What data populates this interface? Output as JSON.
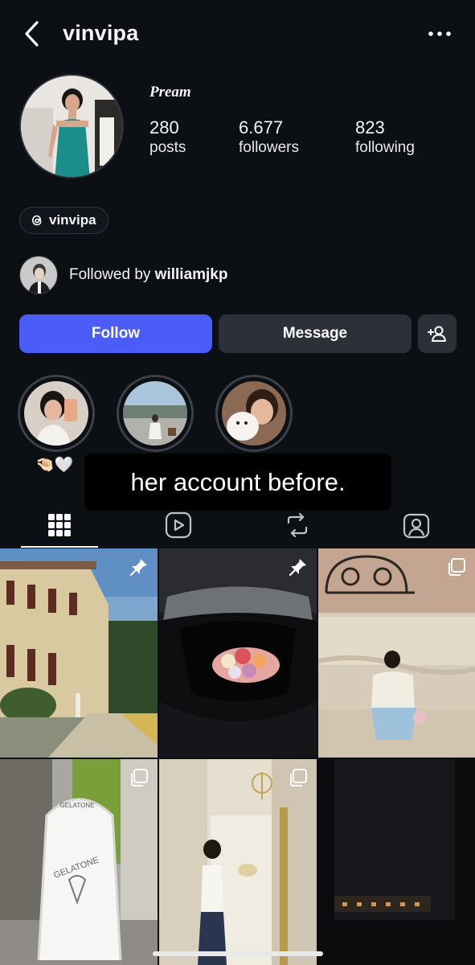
{
  "header": {
    "username": "vinvipa",
    "back_icon": "chevron-left-icon",
    "more_icon": "more-horizontal-icon"
  },
  "profile": {
    "display_name": "Pream",
    "stats": [
      {
        "value": "280",
        "label": "posts"
      },
      {
        "value": "6.677",
        "label": "followers"
      },
      {
        "value": "823",
        "label": "following"
      }
    ],
    "threads_handle": "vinvipa",
    "followed_by_prefix": "Followed by",
    "followed_by_user": "williamjkp"
  },
  "actions": {
    "follow_label": "Follow",
    "message_label": "Message",
    "add_user_icon": "add-user-icon"
  },
  "highlights": {
    "first_label": "🤏🏻🤍"
  },
  "overlay": {
    "caption": "her account before."
  },
  "tabs": [
    "grid-icon",
    "reels-icon",
    "reposts-icon",
    "tagged-icon"
  ],
  "colors": {
    "background": "#0c0f14",
    "follow_button": "#4a5df9",
    "secondary_button": "#2c3038"
  }
}
